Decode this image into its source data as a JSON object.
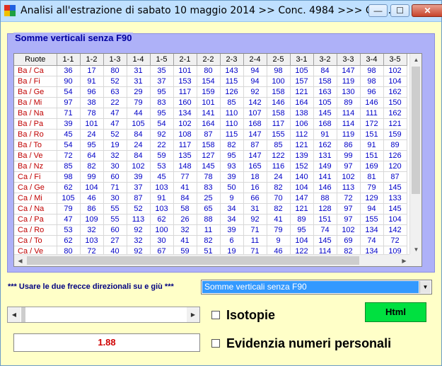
{
  "window": {
    "title": "Analisi all'estrazione di sabato 10 maggio 2014 >> Conc. 4984 >>> Con...",
    "minimize_glyph": "—",
    "maximize_glyph": "☐",
    "close_glyph": "✕"
  },
  "group": {
    "title": "Somme verticali senza F90"
  },
  "grid": {
    "columns": [
      "Ruote",
      "1-1",
      "1-2",
      "1-3",
      "1-4",
      "1-5",
      "2-1",
      "2-2",
      "2-3",
      "2-4",
      "2-5",
      "3-1",
      "3-2",
      "3-3",
      "3-4",
      "3-5"
    ],
    "rows": [
      [
        "Ba / Ca",
        "36",
        "17",
        "80",
        "31",
        "35",
        "101",
        "80",
        "143",
        "94",
        "98",
        "105",
        "84",
        "147",
        "98",
        "102"
      ],
      [
        "Ba / Fi",
        "90",
        "91",
        "52",
        "31",
        "37",
        "153",
        "154",
        "115",
        "94",
        "100",
        "157",
        "158",
        "119",
        "98",
        "104"
      ],
      [
        "Ba / Ge",
        "54",
        "96",
        "63",
        "29",
        "95",
        "117",
        "159",
        "126",
        "92",
        "158",
        "121",
        "163",
        "130",
        "96",
        "162"
      ],
      [
        "Ba / Mi",
        "97",
        "38",
        "22",
        "79",
        "83",
        "160",
        "101",
        "85",
        "142",
        "146",
        "164",
        "105",
        "89",
        "146",
        "150"
      ],
      [
        "Ba / Na",
        "71",
        "78",
        "47",
        "44",
        "95",
        "134",
        "141",
        "110",
        "107",
        "158",
        "138",
        "145",
        "114",
        "111",
        "162"
      ],
      [
        "Ba / Pa",
        "39",
        "101",
        "47",
        "105",
        "54",
        "102",
        "164",
        "110",
        "168",
        "117",
        "106",
        "168",
        "114",
        "172",
        "121"
      ],
      [
        "Ba / Ro",
        "45",
        "24",
        "52",
        "84",
        "92",
        "108",
        "87",
        "115",
        "147",
        "155",
        "112",
        "91",
        "119",
        "151",
        "159"
      ],
      [
        "Ba / To",
        "54",
        "95",
        "19",
        "24",
        "22",
        "117",
        "158",
        "82",
        "87",
        "85",
        "121",
        "162",
        "86",
        "91",
        "89"
      ],
      [
        "Ba / Ve",
        "72",
        "64",
        "32",
        "84",
        "59",
        "135",
        "127",
        "95",
        "147",
        "122",
        "139",
        "131",
        "99",
        "151",
        "126"
      ],
      [
        "Ba / Nz",
        "85",
        "82",
        "30",
        "102",
        "53",
        "148",
        "145",
        "93",
        "165",
        "116",
        "152",
        "149",
        "97",
        "169",
        "120"
      ],
      [
        "Ca / Fi",
        "98",
        "99",
        "60",
        "39",
        "45",
        "77",
        "78",
        "39",
        "18",
        "24",
        "140",
        "141",
        "102",
        "81",
        "87"
      ],
      [
        "Ca / Ge",
        "62",
        "104",
        "71",
        "37",
        "103",
        "41",
        "83",
        "50",
        "16",
        "82",
        "104",
        "146",
        "113",
        "79",
        "145"
      ],
      [
        "Ca / Mi",
        "105",
        "46",
        "30",
        "87",
        "91",
        "84",
        "25",
        "9",
        "66",
        "70",
        "147",
        "88",
        "72",
        "129",
        "133"
      ],
      [
        "Ca / Na",
        "79",
        "86",
        "55",
        "52",
        "103",
        "58",
        "65",
        "34",
        "31",
        "82",
        "121",
        "128",
        "97",
        "94",
        "145"
      ],
      [
        "Ca / Pa",
        "47",
        "109",
        "55",
        "113",
        "62",
        "26",
        "88",
        "34",
        "92",
        "41",
        "89",
        "151",
        "97",
        "155",
        "104"
      ],
      [
        "Ca / Ro",
        "53",
        "32",
        "60",
        "92",
        "100",
        "32",
        "11",
        "39",
        "71",
        "79",
        "95",
        "74",
        "102",
        "134",
        "142"
      ],
      [
        "Ca / To",
        "62",
        "103",
        "27",
        "32",
        "30",
        "41",
        "82",
        "6",
        "11",
        "9",
        "104",
        "145",
        "69",
        "74",
        "72"
      ],
      [
        "Ca / Ve",
        "80",
        "72",
        "40",
        "92",
        "67",
        "59",
        "51",
        "19",
        "71",
        "46",
        "122",
        "114",
        "82",
        "134",
        "109"
      ]
    ]
  },
  "hint_text": "*** Usare le due frecce direzionali su e giù ***",
  "combo": {
    "selected": "Somme verticali senza F90"
  },
  "isotopie_label": "Isotopie",
  "evidenzia_label": "Evidenzia numeri personali",
  "html_button_label": "Html",
  "value_display": "1.88",
  "icons": {
    "arrow_up": "▲",
    "arrow_down": "▼",
    "arrow_left": "◀",
    "arrow_right": "▶"
  },
  "colors": {
    "accent_values": "#0000c8",
    "row_labels": "#c00000",
    "group_bg": "#aeb1f8",
    "window_bg": "#ffffc8",
    "html_button": "#00e040"
  }
}
